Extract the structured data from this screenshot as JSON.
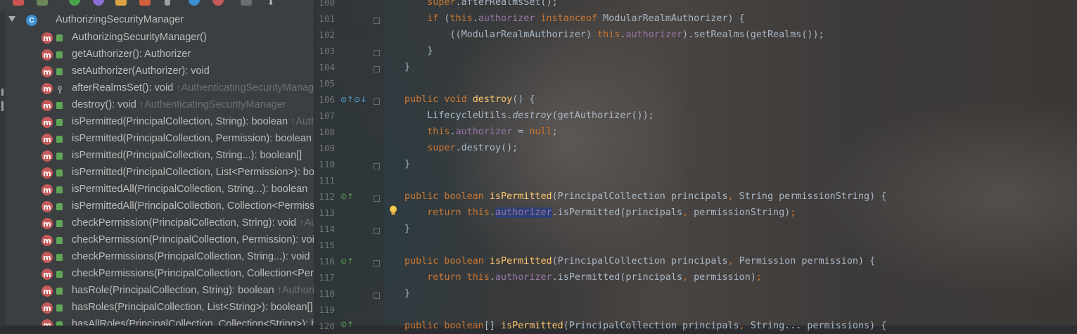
{
  "structure": {
    "class_name": "AuthorizingSecurityManager",
    "class_icon_letter": "C",
    "method_icon_letter": "m",
    "items": [
      {
        "label": "AuthorizingSecurityManager()",
        "inherited": "",
        "access": "public"
      },
      {
        "label": "getAuthorizer(): Authorizer",
        "inherited": "",
        "access": "public"
      },
      {
        "label": "setAuthorizer(Authorizer): void",
        "inherited": "",
        "access": "public"
      },
      {
        "label": "afterRealmsSet(): void ",
        "inherited": "↑AuthenticatingSecurityManager",
        "access": "protected"
      },
      {
        "label": "destroy(): void ",
        "inherited": "↑AuthenticatingSecurityManager",
        "access": "public"
      },
      {
        "label": "isPermitted(PrincipalCollection, String): boolean ",
        "inherited": "↑Authorizer",
        "access": "public"
      },
      {
        "label": "isPermitted(PrincipalCollection, Permission): boolean",
        "inherited": "",
        "access": "public"
      },
      {
        "label": "isPermitted(PrincipalCollection, String...): boolean[]",
        "inherited": "",
        "access": "public"
      },
      {
        "label": "isPermitted(PrincipalCollection, List<Permission>): boolean[]",
        "inherited": "",
        "access": "public"
      },
      {
        "label": "isPermittedAll(PrincipalCollection, String...): boolean",
        "inherited": "",
        "access": "public"
      },
      {
        "label": "isPermittedAll(PrincipalCollection, Collection<Permission>): boolean",
        "inherited": "",
        "access": "public"
      },
      {
        "label": "checkPermission(PrincipalCollection, String): void ",
        "inherited": "↑Authorizer",
        "access": "public"
      },
      {
        "label": "checkPermission(PrincipalCollection, Permission): void",
        "inherited": "",
        "access": "public"
      },
      {
        "label": "checkPermissions(PrincipalCollection, String...): void",
        "inherited": "",
        "access": "public"
      },
      {
        "label": "checkPermissions(PrincipalCollection, Collection<Permission>): void",
        "inherited": "",
        "access": "public"
      },
      {
        "label": "hasRole(PrincipalCollection, String): boolean ",
        "inherited": "↑Authorizer",
        "access": "public"
      },
      {
        "label": "hasRoles(PrincipalCollection, List<String>): boolean[]",
        "inherited": "",
        "access": "public"
      },
      {
        "label": "hasAllRoles(PrincipalCollection, Collection<String>): boolean",
        "inherited": "",
        "access": "public"
      }
    ]
  },
  "editor": {
    "line_numbers": [
      "100",
      "101",
      "102",
      "103",
      "104",
      "105",
      "106",
      "107",
      "108",
      "109",
      "110",
      "111",
      "112",
      "113",
      "114",
      "115",
      "116",
      "117",
      "118",
      "119",
      "120"
    ],
    "highlighted_word": "authorizer"
  }
}
